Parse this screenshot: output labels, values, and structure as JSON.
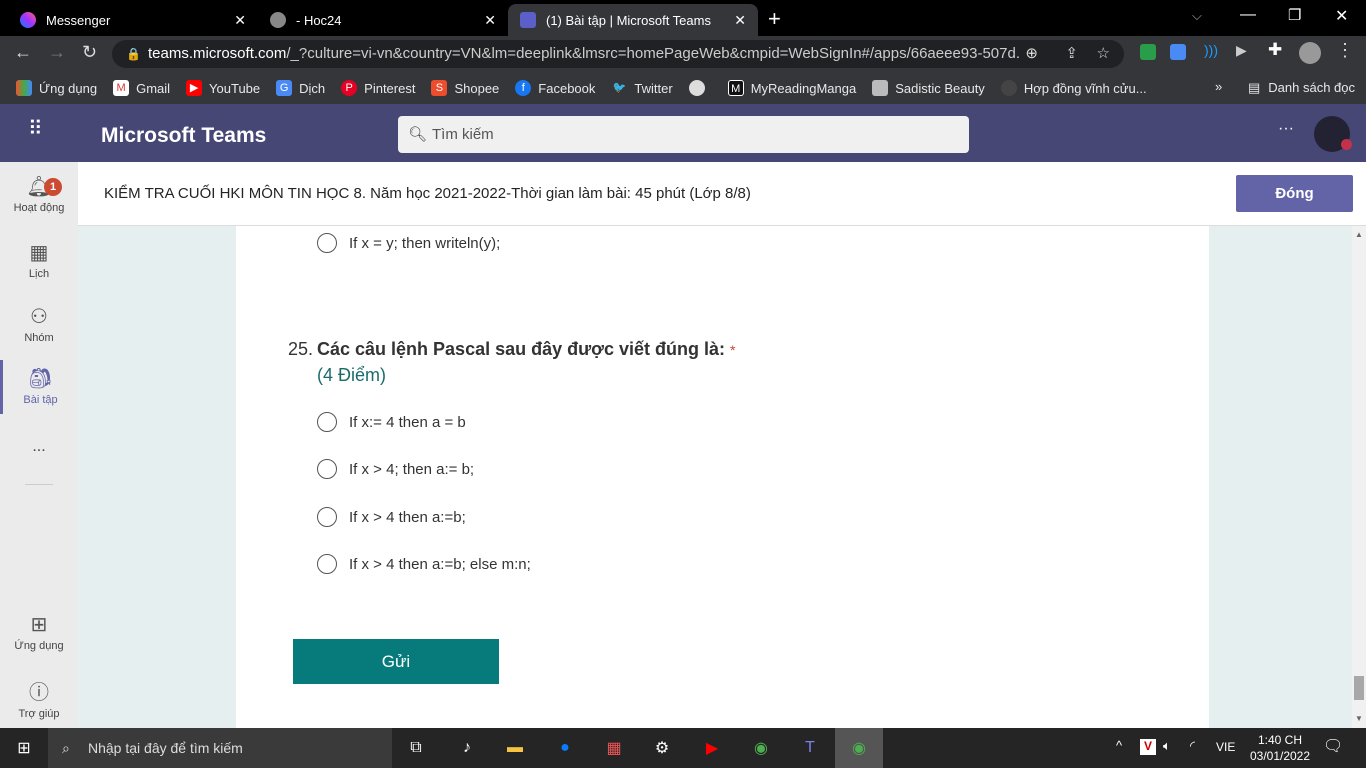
{
  "browser": {
    "tabs": [
      {
        "title": "Messenger",
        "icon": "messenger-icon"
      },
      {
        "title": "- Hoc24",
        "icon": "globe-icon"
      },
      {
        "title": "(1) Bài tập | Microsoft Teams",
        "icon": "teams-icon",
        "active": true
      }
    ],
    "url_host": "teams.microsoft.com",
    "url_rest": "/_?culture=vi-vn&country=VN&lm=deeplink&lmsrc=homePageWeb&cmpid=WebSignIn#/apps/66aeee93-507d...",
    "bookmarks": [
      "Ứng dụng",
      "Gmail",
      "YouTube",
      "Dịch",
      "Pinterest",
      "Shopee",
      "Facebook",
      "Twitter",
      "",
      "MyReadingManga",
      "Sadistic Beauty",
      "Hợp đồng vĩnh cửu..."
    ],
    "more": "»",
    "reading_list": "Danh sách đọc"
  },
  "teams": {
    "app_name": "Microsoft Teams",
    "search_placeholder": "Tìm kiếm",
    "more": "···",
    "rail": [
      {
        "label": "Hoạt động",
        "badge": "1"
      },
      {
        "label": "Lịch"
      },
      {
        "label": "Nhóm"
      },
      {
        "label": "Bài tập",
        "active": true
      },
      {
        "label": "..."
      },
      {
        "label": "Ứng dụng"
      },
      {
        "label": "Trợ giúp"
      }
    ],
    "title": "KIỂM TRA CUỐI HKI MÔN TIN HỌC 8. Năm học 2021-2022-Thời gian làm bài: 45 phút (Lớp 8/8)",
    "close_label": "Đóng",
    "accent": "#6264a7",
    "header_color": "#464775"
  },
  "form": {
    "prev_option": "If x = y; then writeln(y);",
    "question_number": "25.",
    "question": "Các câu lệnh Pascal sau đây được viết đúng là:",
    "required": "*",
    "points": "(4 Điểm)",
    "options": [
      "If x:= 4 then a = b",
      "If x > 4; then a:= b;",
      "If x > 4 then a:=b;",
      "If x > 4 then a:=b; else m:n;"
    ],
    "submit": "Gửi",
    "submit_color": "#077b7b"
  },
  "taskbar": {
    "search_placeholder": "Nhập tại đây để tìm kiếm",
    "lang": "VIE",
    "time": "1:40 CH",
    "date": "03/01/2022"
  }
}
